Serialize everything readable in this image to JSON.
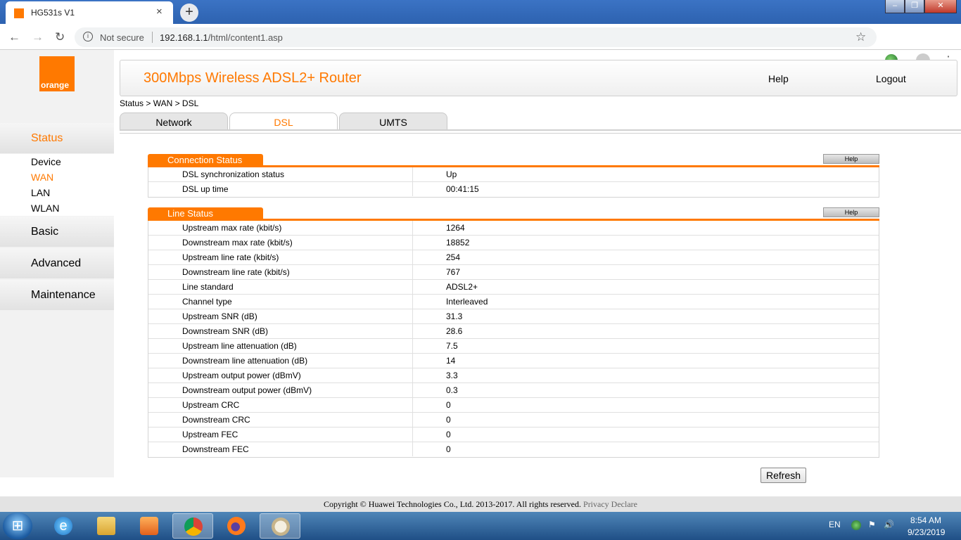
{
  "browser": {
    "tab_title": "HG531s V1",
    "tab_close": "×",
    "new_tab": "+",
    "security_label": "Not secure",
    "url_host": "192.168.1.1",
    "url_path": "/html/content1.asp"
  },
  "logo": {
    "text": "orange"
  },
  "header": {
    "title": "300Mbps Wireless ADSL2+ Router",
    "help": "Help",
    "logout": "Logout"
  },
  "breadcrumb": "Status > WAN > DSL",
  "tabs": [
    "Network",
    "DSL",
    "UMTS"
  ],
  "sidebar": {
    "status": "Status",
    "status_items": [
      "Device",
      "WAN",
      "LAN",
      "WLAN"
    ],
    "basic": "Basic",
    "advanced": "Advanced",
    "maintenance": "Maintenance"
  },
  "connection_status": {
    "title": "Connection Status",
    "help": "Help",
    "rows": [
      {
        "label": "DSL synchronization status",
        "value": "Up"
      },
      {
        "label": "DSL up time",
        "value": "00:41:15"
      }
    ]
  },
  "line_status": {
    "title": "Line Status",
    "help": "Help",
    "rows": [
      {
        "label": "Upstream max rate (kbit/s)",
        "value": "1264"
      },
      {
        "label": "Downstream max rate (kbit/s)",
        "value": "18852"
      },
      {
        "label": "Upstream line rate (kbit/s)",
        "value": "254"
      },
      {
        "label": "Downstream line rate (kbit/s)",
        "value": "767"
      },
      {
        "label": "Line standard",
        "value": "ADSL2+"
      },
      {
        "label": "Channel type",
        "value": "Interleaved"
      },
      {
        "label": "Upstream SNR (dB)",
        "value": "31.3"
      },
      {
        "label": "Downstream SNR (dB)",
        "value": "28.6"
      },
      {
        "label": "Upstream line attenuation (dB)",
        "value": "7.5"
      },
      {
        "label": "Downstream line attenuation (dB)",
        "value": "14"
      },
      {
        "label": "Upstream output power (dBmV)",
        "value": "3.3"
      },
      {
        "label": "Downstream output power (dBmV)",
        "value": "0.3"
      },
      {
        "label": "Upstream CRC",
        "value": "0"
      },
      {
        "label": "Downstream CRC",
        "value": "0"
      },
      {
        "label": "Upstream FEC",
        "value": "0"
      },
      {
        "label": "Downstream FEC",
        "value": "0"
      }
    ]
  },
  "refresh_label": "Refresh",
  "footer": {
    "copyright": "Copyright © Huawei Technologies Co., Ltd. 2013-2017. All rights reserved.",
    "privacy": "Privacy Declare"
  },
  "taskbar": {
    "apps": [
      "internet-explorer-icon",
      "file-explorer-icon",
      "media-player-icon",
      "chrome-icon",
      "firefox-icon",
      "paint-icon"
    ],
    "active_app": "chrome-icon",
    "language": "EN",
    "time": "8:54 AM",
    "date": "9/23/2019"
  },
  "colors": {
    "accent": "#ff7900",
    "sidebar_bg": "#f2f2f2",
    "tab_bg": "#e6e6e6"
  }
}
